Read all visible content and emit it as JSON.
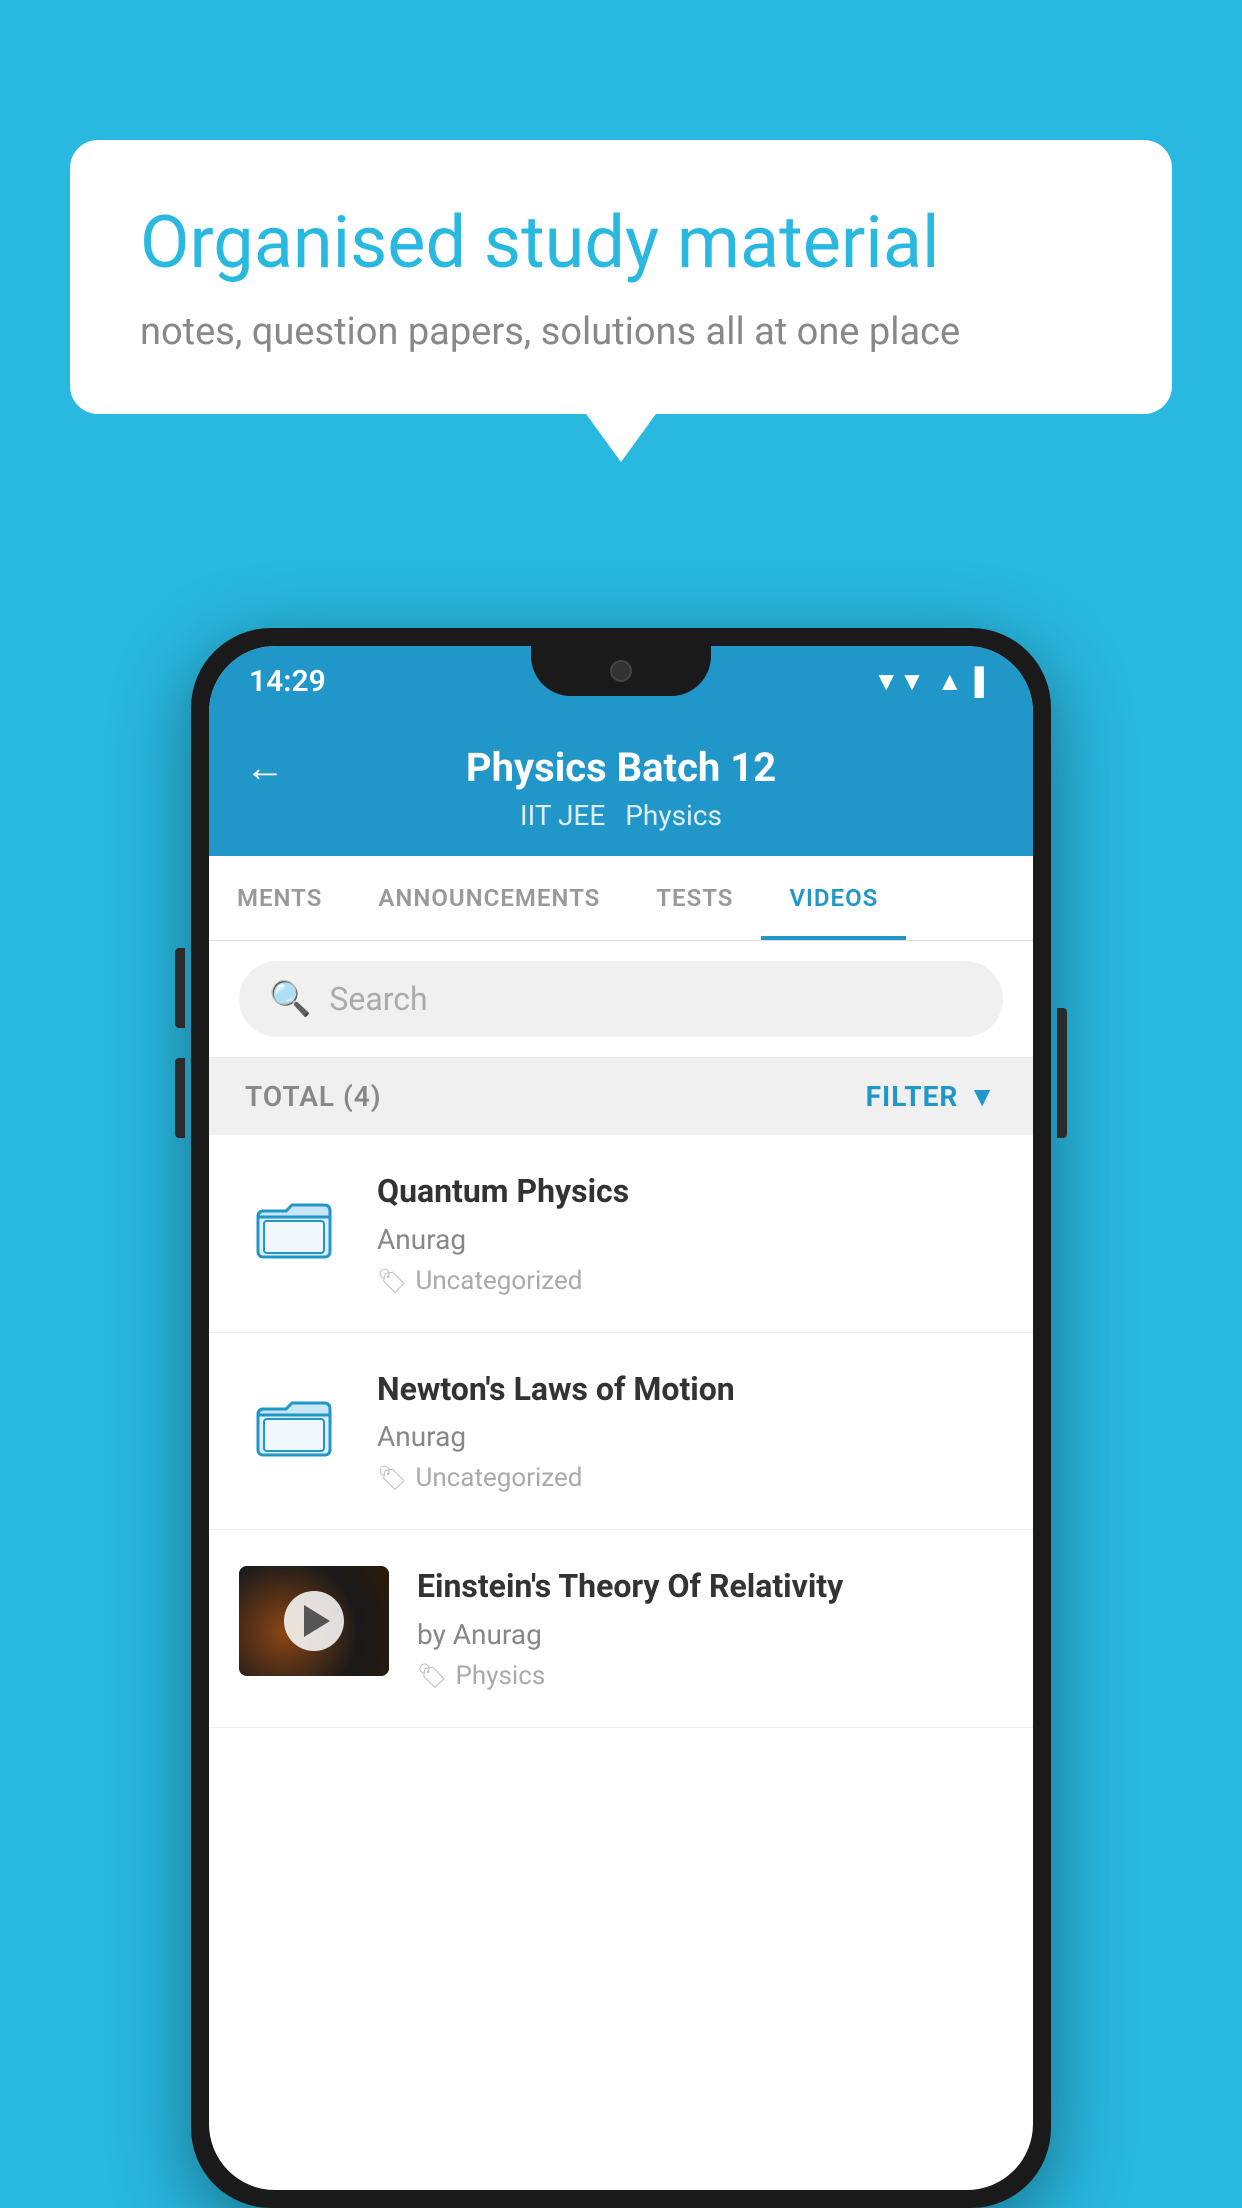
{
  "background_color": "#29b8e0",
  "speech_bubble": {
    "title": "Organised study material",
    "subtitle": "notes, question papers, solutions all at one place"
  },
  "phone": {
    "status_bar": {
      "time": "14:29",
      "icons": [
        "wifi",
        "signal",
        "battery"
      ]
    },
    "header": {
      "back_label": "←",
      "title": "Physics Batch 12",
      "tag1": "IIT JEE",
      "tag2": "Physics"
    },
    "tabs": [
      {
        "label": "MENTS",
        "active": false
      },
      {
        "label": "ANNOUNCEMENTS",
        "active": false
      },
      {
        "label": "TESTS",
        "active": false
      },
      {
        "label": "VIDEOS",
        "active": true
      }
    ],
    "search": {
      "placeholder": "Search"
    },
    "filter_bar": {
      "total_label": "TOTAL (4)",
      "filter_label": "FILTER"
    },
    "video_items": [
      {
        "id": 1,
        "title": "Quantum Physics",
        "author": "Anurag",
        "tag": "Uncategorized",
        "has_thumb": false
      },
      {
        "id": 2,
        "title": "Newton's Laws of Motion",
        "author": "Anurag",
        "tag": "Uncategorized",
        "has_thumb": false
      },
      {
        "id": 3,
        "title": "Einstein's Theory Of Relativity",
        "author": "by Anurag",
        "tag": "Physics",
        "has_thumb": true
      }
    ]
  }
}
